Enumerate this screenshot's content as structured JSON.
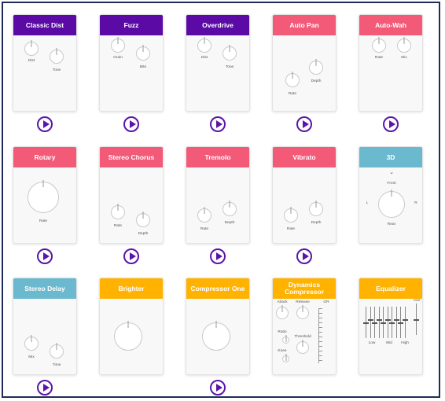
{
  "colors": {
    "distortion": "#5b0aa6",
    "modulation": "#f25a78",
    "spatial": "#6bb9cf",
    "dynamics": "#ffb300",
    "play": "#5a15a8"
  },
  "effects": [
    {
      "name": "Classic Dist",
      "color": "distortion",
      "knobs": [
        "Dist",
        "Tone"
      ],
      "has_play": true,
      "play_icon": "play-circle-icon"
    },
    {
      "name": "Fuzz",
      "color": "distortion",
      "knobs": [
        "Grain",
        "Bite"
      ],
      "has_play": true,
      "play_icon": "play-circle-icon"
    },
    {
      "name": "Overdrive",
      "color": "distortion",
      "knobs": [
        "Dist",
        "Tone"
      ],
      "has_play": true,
      "play_icon": "play-circle-icon"
    },
    {
      "name": "Auto Pan",
      "color": "modulation",
      "knobs": [
        "Rate",
        "Depth"
      ],
      "has_play": true,
      "play_icon": "play-circle-icon"
    },
    {
      "name": "Auto-Wah",
      "color": "modulation",
      "knobs": [
        "Rate",
        "Mix"
      ],
      "has_play": true,
      "play_icon": "play-circle-icon"
    },
    {
      "name": "Rotary",
      "color": "modulation",
      "knobs": [
        "Rate"
      ],
      "has_play": true,
      "play_icon": "play-circle-icon"
    },
    {
      "name": "Stereo Chorus",
      "color": "modulation",
      "knobs": [
        "Rate",
        "Depth"
      ],
      "has_play": true,
      "play_icon": "play-circle-icon"
    },
    {
      "name": "Tremolo",
      "color": "modulation",
      "knobs": [
        "Rate",
        "Depth"
      ],
      "has_play": true,
      "play_icon": "play-circle-icon"
    },
    {
      "name": "Vibrato",
      "color": "modulation",
      "knobs": [
        "Rate",
        "Depth"
      ],
      "has_play": true,
      "play_icon": "play-circle-icon"
    },
    {
      "name": "3D",
      "color": "spatial",
      "knobs": [],
      "panner": {
        "front": "Front",
        "rear": "Rear",
        "left": "L",
        "right": "R",
        "chevron": "chevron-down-icon"
      },
      "has_play": false
    },
    {
      "name": "Stereo Delay",
      "color": "spatial",
      "knobs": [
        "Mix",
        "Time"
      ],
      "has_play": true,
      "play_icon": "play-circle-icon"
    },
    {
      "name": "Brighter",
      "color": "dynamics",
      "knobs": [
        ""
      ],
      "has_play": false
    },
    {
      "name": "Compressor One",
      "color": "dynamics",
      "knobs": [
        ""
      ],
      "has_play": true,
      "play_icon": "play-circle-icon"
    },
    {
      "name": "Dynamics Compressor",
      "color": "dynamics",
      "knobs": [
        "Attack",
        "Release",
        "Ratio",
        "Threshold",
        "Knee"
      ],
      "meter_label": "GR",
      "has_play": false
    },
    {
      "name": "Equalizer",
      "color": "dynamics",
      "knobs": [],
      "eq": {
        "bands": [
          "Low",
          "Mid",
          "High"
        ],
        "out_label": "Out"
      },
      "has_play": false
    }
  ]
}
